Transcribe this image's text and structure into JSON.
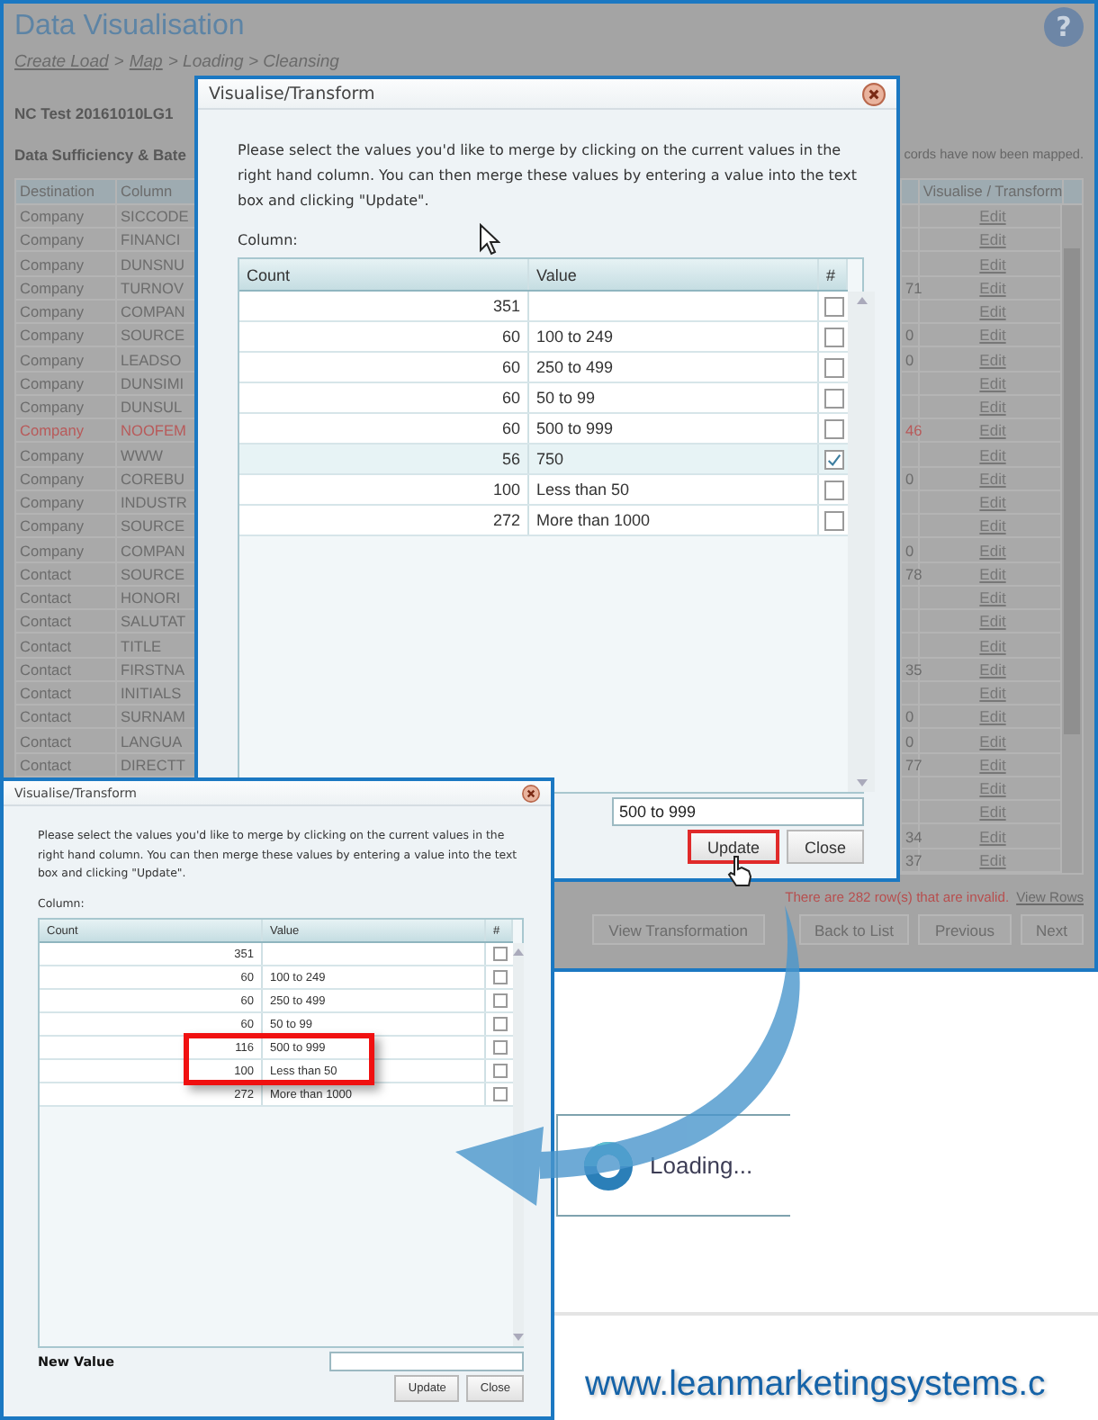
{
  "page": {
    "title": "Data Visualisation",
    "help_icon": "?",
    "breadcrumb": [
      {
        "label": "Create Load",
        "link": true
      },
      {
        "label": ">",
        "link": false
      },
      {
        "label": "Map",
        "link": true
      },
      {
        "label": "> Loading > Cleansing",
        "link": false
      }
    ],
    "load_name": "NC Test 20161010LG1",
    "section_title": "Data Sufficiency & Bate",
    "mapped_note": "cords have now been mapped.",
    "table": {
      "columns": [
        "Destination",
        "Column",
        "Visualise / Transform"
      ],
      "rows": [
        {
          "destination": "Company",
          "column": "SICCODE",
          "action": "Edit",
          "invalid": false
        },
        {
          "destination": "Company",
          "column": "FINANCI",
          "action": "Edit",
          "invalid": false
        },
        {
          "destination": "Company",
          "column": "DUNSNU",
          "action": "Edit",
          "invalid": false
        },
        {
          "destination": "Company",
          "column": "TURNOV",
          "column_3": "71",
          "action": "Edit",
          "invalid": false
        },
        {
          "destination": "Company",
          "column": "COMPAN",
          "action": "Edit",
          "invalid": false
        },
        {
          "destination": "Company",
          "column": "SOURCE",
          "column_3": "0",
          "action": "Edit",
          "invalid": false
        },
        {
          "destination": "Company",
          "column": "LEADSO",
          "column_3": "0",
          "action": "Edit",
          "invalid": false
        },
        {
          "destination": "Company",
          "column": "DUNSIMI",
          "action": "Edit",
          "invalid": false
        },
        {
          "destination": "Company",
          "column": "DUNSUL",
          "action": "Edit",
          "invalid": false
        },
        {
          "destination": "Company",
          "column": "NOOFEM",
          "column_3": "46",
          "action": "Edit",
          "invalid": true
        },
        {
          "destination": "Company",
          "column": "WWW",
          "action": "Edit",
          "invalid": false
        },
        {
          "destination": "Company",
          "column": "COREBU",
          "column_3": "0",
          "action": "Edit",
          "invalid": false
        },
        {
          "destination": "Company",
          "column": "INDUSTR",
          "action": "Edit",
          "invalid": false
        },
        {
          "destination": "Company",
          "column": "SOURCE",
          "action": "Edit",
          "invalid": false
        },
        {
          "destination": "Company",
          "column": "COMPAN",
          "column_3": "0",
          "action": "Edit",
          "invalid": false
        },
        {
          "destination": "Contact",
          "column": "SOURCE",
          "column_3": "78",
          "action": "Edit",
          "invalid": false
        },
        {
          "destination": "Contact",
          "column": "HONORI",
          "action": "Edit",
          "invalid": false
        },
        {
          "destination": "Contact",
          "column": "SALUTAT",
          "action": "Edit",
          "invalid": false
        },
        {
          "destination": "Contact",
          "column": "TITLE",
          "action": "Edit",
          "invalid": false
        },
        {
          "destination": "Contact",
          "column": "FIRSTNA",
          "column_3": "35",
          "action": "Edit",
          "invalid": false
        },
        {
          "destination": "Contact",
          "column": "INITIALS",
          "action": "Edit",
          "invalid": false
        },
        {
          "destination": "Contact",
          "column": "SURNAM",
          "column_3": "0",
          "action": "Edit",
          "invalid": false
        },
        {
          "destination": "Contact",
          "column": "LANGUA",
          "column_3": "0",
          "action": "Edit",
          "invalid": false
        },
        {
          "destination": "Contact",
          "column": "DIRECTT",
          "column_3": "77",
          "action": "Edit",
          "invalid": false
        },
        {
          "action": "Edit"
        },
        {
          "action": "Edit"
        },
        {
          "column_3": "34",
          "action": "Edit",
          "invalid": false
        },
        {
          "column_3": "37",
          "action": "Edit",
          "invalid": false
        }
      ]
    },
    "invalid_note": "There are 282 row(s) that are invalid.",
    "invalid_link": "View Rows",
    "buttons": [
      "View Transformation",
      "Back to List",
      "Previous",
      "Next"
    ]
  },
  "dialog_before": {
    "title": "Visualise/Transform",
    "instructions": "Please select the values you'd like to merge by clicking on the current values in the right hand column. You can then merge these values by entering a value into the text box and clicking \"Update\".",
    "column_label": "Column:",
    "table": {
      "columns": [
        "Count",
        "Value",
        "#"
      ],
      "rows": [
        {
          "count": "351",
          "checked": false
        },
        {
          "count": "60",
          "value": "100 to 249",
          "checked": false
        },
        {
          "count": "60",
          "value": "250 to 499",
          "checked": false
        },
        {
          "count": "60",
          "value": "50 to 99",
          "checked": false
        },
        {
          "count": "60",
          "value": "500 to 999",
          "checked": false
        },
        {
          "count": "56",
          "value": "750",
          "checked": true
        },
        {
          "count": "100",
          "value": "Less than 50",
          "checked": false
        },
        {
          "count": "272",
          "value": "More than 1000",
          "checked": false
        }
      ]
    },
    "new_value": "500 to 999",
    "buttons": [
      {
        "label": "Update",
        "highlighted": true
      },
      {
        "label": "Close",
        "highlighted": false
      }
    ]
  },
  "dialog_after": {
    "title": "Visualise/Transform",
    "instructions": "Please select the values you'd like to merge by clicking on the current values in the right hand column. You can then merge these values by entering a value into the text box and clicking \"Update\".",
    "column_label": "Column:",
    "table": {
      "columns": [
        "Count",
        "Value",
        "#"
      ],
      "rows": [
        {
          "count": "351",
          "checked": false,
          "highlighted": false
        },
        {
          "count": "60",
          "value": "100 to 249",
          "checked": false,
          "highlighted": false
        },
        {
          "count": "60",
          "value": "250 to 499",
          "checked": false,
          "highlighted": false
        },
        {
          "count": "60",
          "value": "50 to 99",
          "checked": false,
          "highlighted": false
        },
        {
          "count": "116",
          "value": "500 to 999",
          "checked": false,
          "highlighted": true
        },
        {
          "count": "100",
          "value": "Less than 50",
          "checked": false,
          "highlighted": true
        },
        {
          "count": "272",
          "value": "More than 1000",
          "checked": false,
          "highlighted": false
        }
      ]
    },
    "new_value_label": "New Value",
    "buttons": [
      {
        "label": "Update",
        "highlighted": false
      },
      {
        "label": "Close",
        "highlighted": false
      }
    ]
  },
  "loading": {
    "text": "Loading..."
  },
  "website": "www.leanmarketingsystems.c"
}
